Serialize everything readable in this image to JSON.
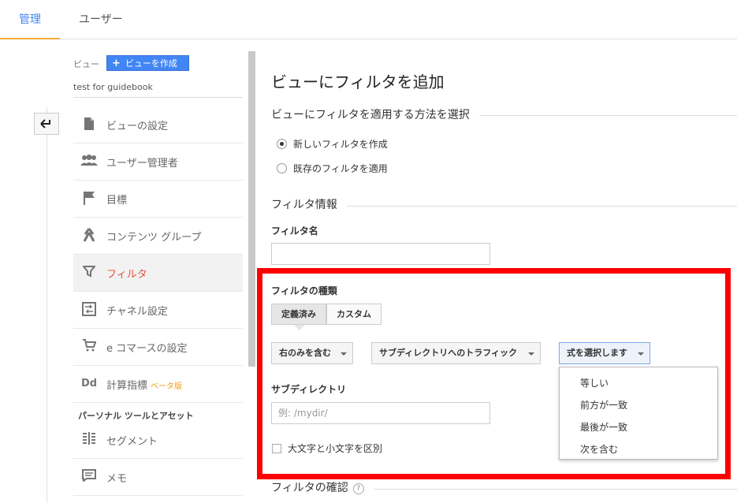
{
  "topnav": {
    "tabs": [
      {
        "label": "管理"
      },
      {
        "label": "ユーザー"
      }
    ]
  },
  "sidebar": {
    "view_label": "ビュー",
    "create_view_label": "ビューを作成",
    "view_name": "test for guidebook",
    "items": [
      {
        "label": "ビューの設定",
        "icon": "document-icon"
      },
      {
        "label": "ユーザー管理者",
        "icon": "users-icon"
      },
      {
        "label": "目標",
        "icon": "flag-icon"
      },
      {
        "label": "コンテンツ グループ",
        "icon": "content-group-icon"
      },
      {
        "label": "フィルタ",
        "icon": "filter-icon"
      },
      {
        "label": "チャネル設定",
        "icon": "channel-icon"
      },
      {
        "label": "e コマースの設定",
        "icon": "cart-icon"
      },
      {
        "label": "計算指標",
        "icon": "dd-icon",
        "beta": "ベータ版"
      }
    ],
    "section_heading": "パーソナル ツールとアセット",
    "tools": [
      {
        "label": "セグメント",
        "icon": "segment-icon"
      },
      {
        "label": "メモ",
        "icon": "memo-icon"
      }
    ],
    "dd_glyph": "Dd"
  },
  "main": {
    "title": "ビューにフィルタを追加",
    "method_section": "ビューにフィルタを適用する方法を選択",
    "radio_new": "新しいフィルタを作成",
    "radio_existing": "既存のフィルタを適用",
    "info_section": "フィルタ情報",
    "filter_name_label": "フィルタ名",
    "filter_name_value": "",
    "filter_type_label": "フィルタの種類",
    "type_tabs": [
      {
        "label": "定義済み"
      },
      {
        "label": "カスタム"
      }
    ],
    "dropdown1": "右のみを含む",
    "dropdown2": "サブディレクトリへのトラフィック",
    "dropdown3": "式を選択します",
    "expression_options": [
      "等しい",
      "前方が一致",
      "最後が一致",
      "次を含む"
    ],
    "subdirectory_label": "サブディレクトリ",
    "subdirectory_placeholder": "例: /mydir/",
    "case_sensitive_label": "大文字と小文字を区別",
    "verify_section": "フィルタの確認",
    "help_glyph": "?"
  },
  "colors": {
    "accent_blue": "#4285f4",
    "active_orange": "#f4a93b",
    "active_item": "#e2533c",
    "highlight_red": "#ff0000"
  }
}
